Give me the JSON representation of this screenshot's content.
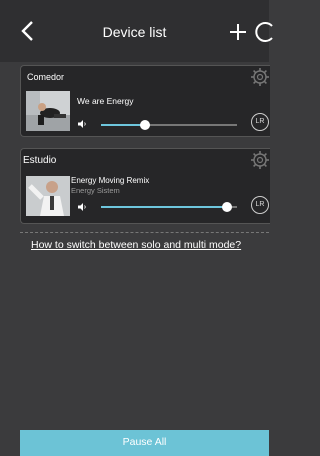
{
  "header": {
    "title": "Device list"
  },
  "devices": [
    {
      "room": "Comedor",
      "song": "We are Energy",
      "artist": "",
      "volume_fraction": 0.32,
      "lr_label": "LR"
    },
    {
      "room": "Estudio",
      "song": "Energy Moving Remix",
      "artist": "Energy Sistem",
      "volume_fraction": 0.93,
      "lr_label": "LR"
    }
  ],
  "help_link": "How to switch between solo and multi mode?",
  "footer": {
    "pause_all": "Pause All"
  },
  "icons": [
    "back-icon",
    "plus-icon",
    "refresh-icon",
    "gear-icon",
    "volume-icon",
    "lr-icon"
  ],
  "colors": {
    "accent": "#6ec6dd",
    "background": "#3b3b3d",
    "header": "#2f2f31",
    "card": "#262628"
  }
}
